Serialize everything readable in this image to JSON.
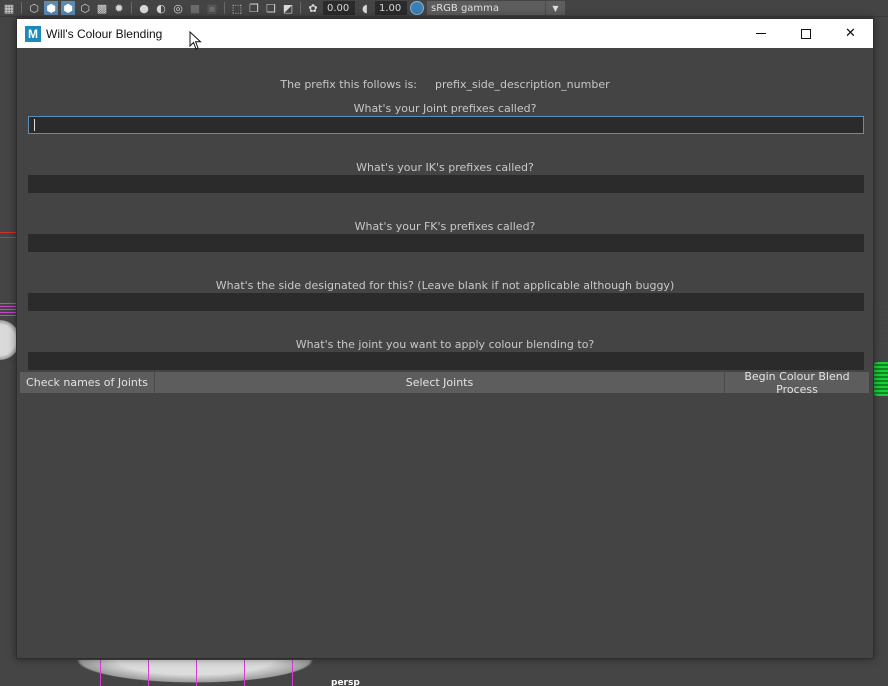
{
  "maya_toolbar": {
    "exposure_value": "0.00",
    "gamma_value": "1.00",
    "color_space": "sRGB gamma"
  },
  "viewport": {
    "camera_label": "persp"
  },
  "window": {
    "app_icon_letter": "M",
    "title": "Will's Colour Blending",
    "controls": {
      "minimize": "",
      "maximize": "",
      "close": "✕"
    }
  },
  "dialog": {
    "prefix_label": "The prefix this follows is:",
    "prefix_format": "prefix_side_description_number",
    "questions": {
      "joint_prefix": "What's your Joint prefixes called?",
      "ik_prefix": "What's your IK's prefixes called?",
      "fk_prefix": "What's your FK's prefixes called?",
      "side": "What's the side designated for this? (Leave blank if not applicable although buggy)",
      "joint": "What's the joint you want to apply colour blending to?"
    },
    "fields": {
      "joint_prefix": "",
      "ik_prefix": "",
      "fk_prefix": "",
      "side": "",
      "joint": ""
    },
    "buttons": {
      "check_names": "Check names of Joints",
      "select_joints": "Select Joints",
      "begin_process": "Begin Colour Blend Process"
    }
  },
  "colors": {
    "background": "#444444",
    "field_bg": "#2b2b2b",
    "button_bg": "#5d5d5d",
    "focus_accent": "#5c8fb8",
    "titlebar": "#ffffff"
  }
}
